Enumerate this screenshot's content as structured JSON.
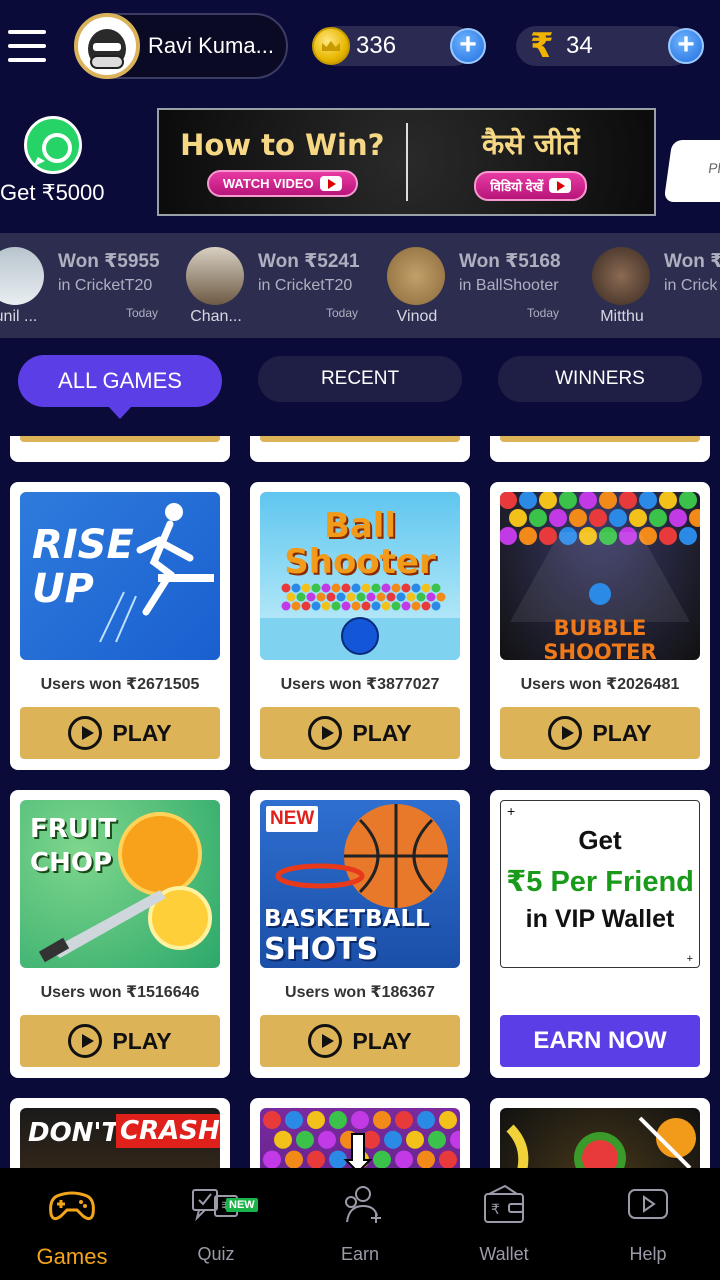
{
  "header": {
    "username": "Ravi Kuma...",
    "coins": "336",
    "cash": "34",
    "cash_symbol": "₹",
    "plus": "+"
  },
  "promo": {
    "whatsapp_text": "Get ₹5000",
    "how_to_win_en": "How to Win?",
    "watch_video_en": "WATCH VIDEO",
    "how_to_win_hi": "कैसे जीतें",
    "watch_video_hi": "विडियो देखें",
    "side_card_text": "Pl"
  },
  "winners": [
    {
      "name": "unil ...",
      "amount": "",
      "game": "",
      "when": "Today"
    },
    {
      "name": "Chan...",
      "amount": "Won ₹5955",
      "game": "in CricketT20",
      "when": "Today"
    },
    {
      "name": "Vinod",
      "amount": "Won ₹5241",
      "game": "in CricketT20",
      "when": "Today"
    },
    {
      "name": "Mitthu",
      "amount": "Won ₹5168",
      "game": "in BallShooter",
      "when": "Today"
    },
    {
      "name": "",
      "amount": "Won ₹5",
      "game": "in Crick",
      "when": ""
    }
  ],
  "tabs": {
    "all": "ALL GAMES",
    "recent": "RECENT",
    "winners": "WINNERS"
  },
  "games": [
    {
      "title_lines": [
        "RISE",
        "UP"
      ],
      "won": "Users won ₹2671505",
      "play": "PLAY"
    },
    {
      "title_lines": [
        "Ball",
        "Shooter"
      ],
      "won": "Users won ₹3877027",
      "play": "PLAY"
    },
    {
      "title_lines": [
        "BUBBLE SHOOTER"
      ],
      "won": "Users won ₹2026481",
      "play": "PLAY"
    },
    {
      "title_lines": [
        "FRUIT",
        "CHOP"
      ],
      "won": "Users won ₹1516646",
      "play": "PLAY"
    },
    {
      "title_lines": [
        "BASKETBALL",
        "SHOTS"
      ],
      "badge": "NEW",
      "won": "Users won ₹186367",
      "play": "PLAY"
    },
    {
      "title_lines": [
        "DON'T",
        "CRASH"
      ]
    }
  ],
  "referral": {
    "line1": "Get",
    "line2": "₹5 Per Friend",
    "line3": "in VIP Wallet",
    "button": "EARN NOW",
    "corner": "+"
  },
  "bottom_nav": {
    "games": "Games",
    "quiz": "Quiz",
    "quiz_badge": "NEW",
    "earn": "Earn",
    "wallet": "Wallet",
    "help": "Help"
  },
  "colors": {
    "background": "#0b0b3a",
    "accent": "#5b3ee6",
    "play_button": "#dcb357",
    "active_nav": "#f2a51a",
    "green_text": "#1a9a1a"
  }
}
